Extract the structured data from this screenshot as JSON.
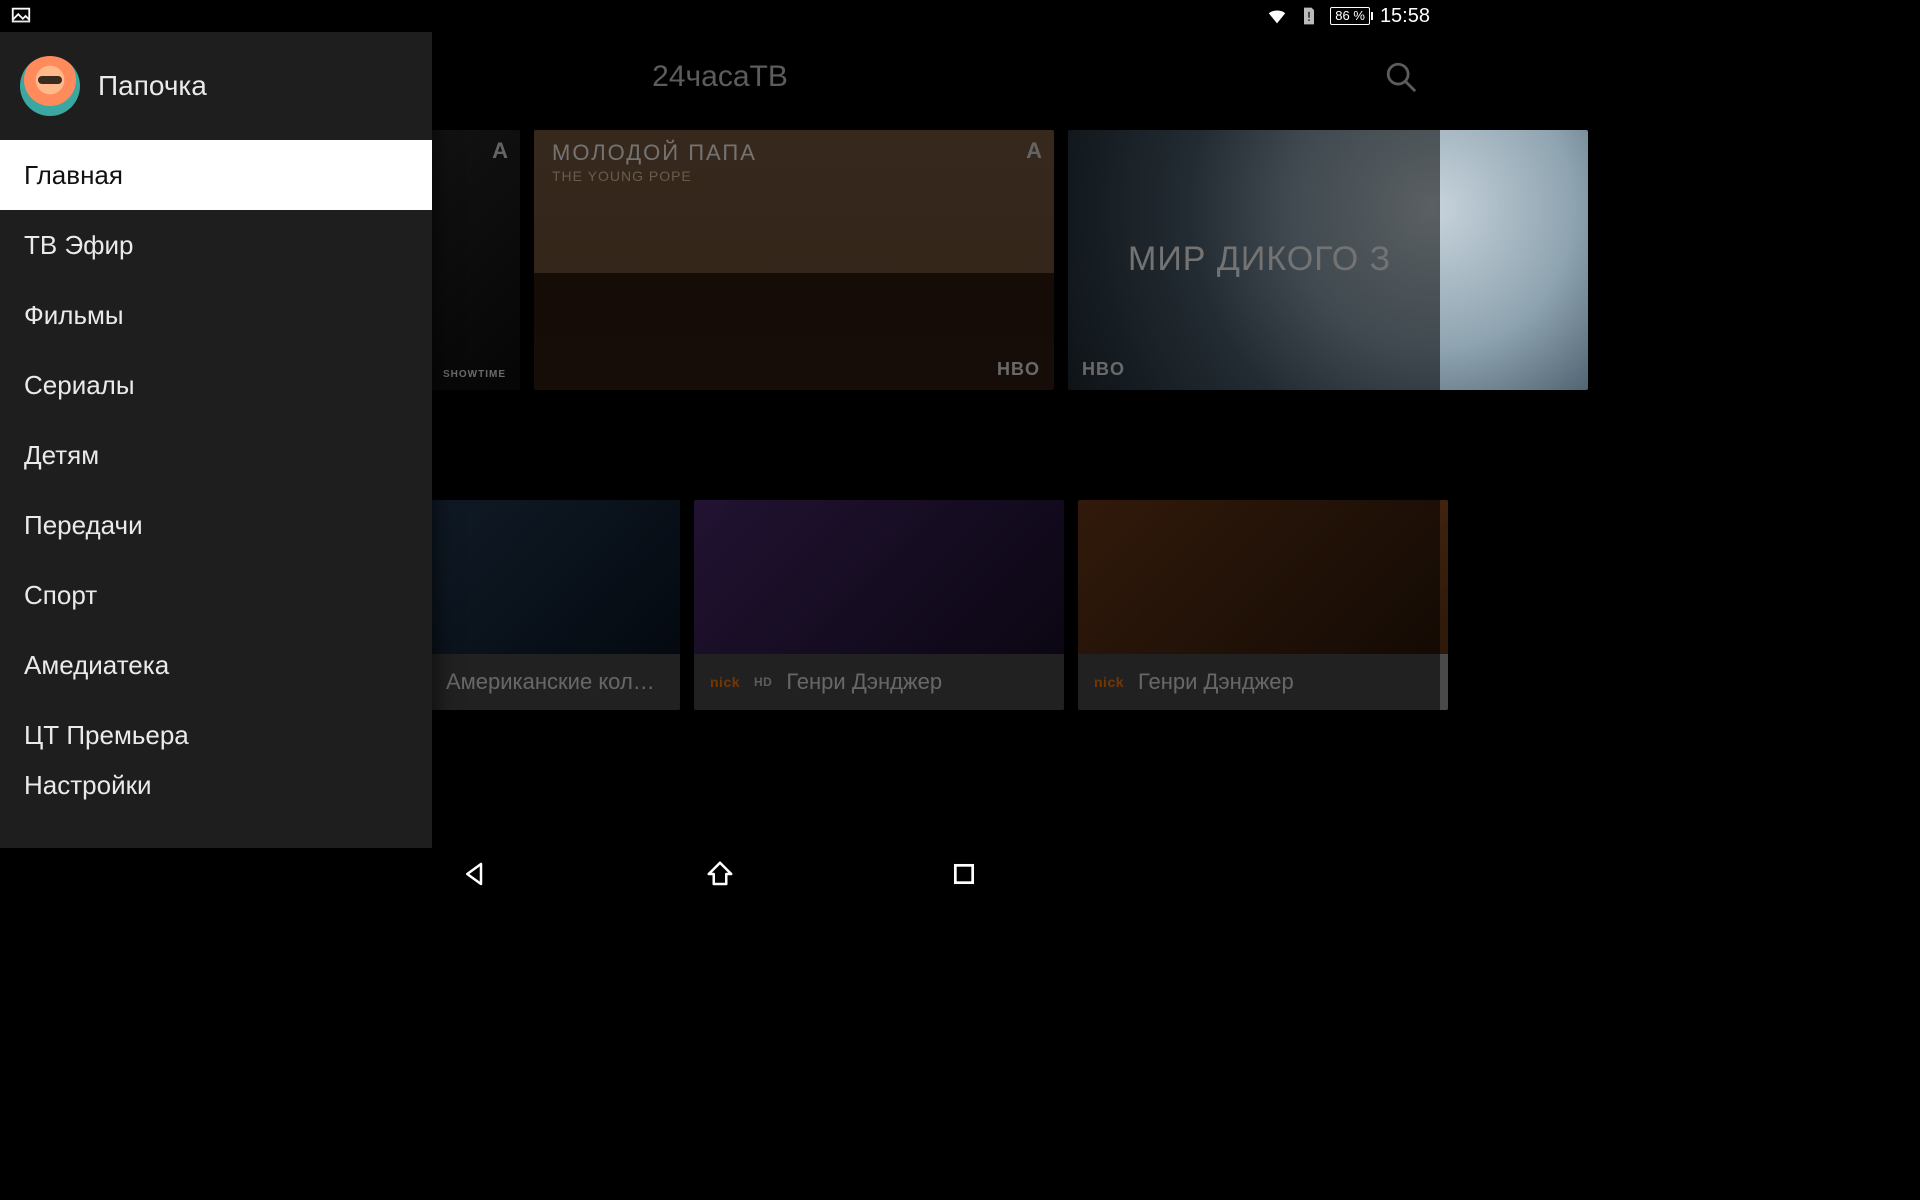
{
  "status_bar": {
    "battery_text": "86 %",
    "clock": "15:58"
  },
  "app": {
    "title": "24часаТВ"
  },
  "drawer": {
    "profile_name": "Папочка",
    "items": [
      "Главная",
      "ТВ Эфир",
      "Фильмы",
      "Сериалы",
      "Детям",
      "Передачи",
      "Спорт",
      "Амедиатека",
      "ЦТ Премьера",
      "Настройки"
    ],
    "active_index": 0
  },
  "hero": {
    "center": {
      "title": "МОЛОДОЙ ПАПА",
      "subtitle": "THE YOUNG POPE",
      "network": "HBO",
      "corner": "A"
    },
    "partial_left": {
      "network": "SHOWTIME",
      "corner": "A"
    },
    "right": {
      "title": "МИР ДИКОГО З",
      "network": "HBO"
    }
  },
  "row2": {
    "tiles": [
      {
        "channel": "",
        "title": "Американские колле…"
      },
      {
        "channel": "nick HD",
        "title": "Генри Дэнджер"
      },
      {
        "channel": "nick",
        "title": "Генри Дэнджер"
      }
    ]
  }
}
